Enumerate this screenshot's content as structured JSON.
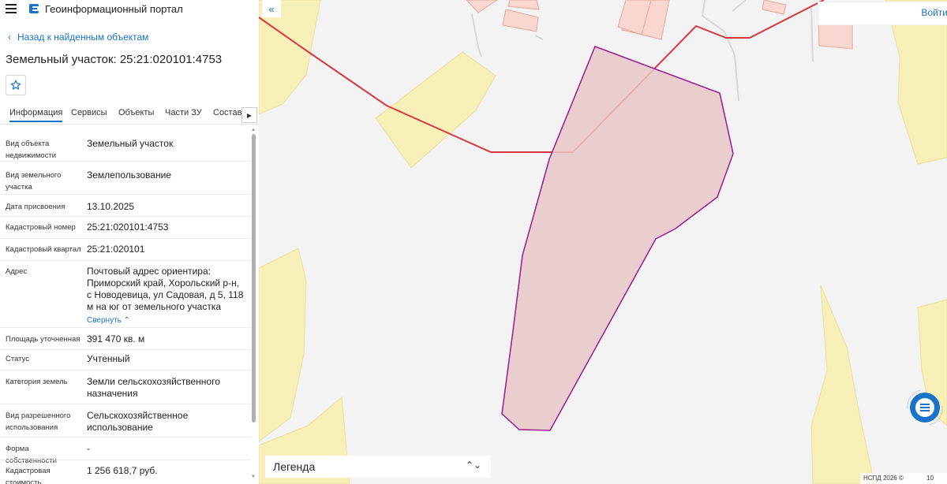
{
  "header": {
    "app_title": "Геоинформационный портал"
  },
  "back_link": "Назад к найденным объектам",
  "page_title": "Земельный участок: 25:21:020101:4753",
  "tabs": [
    {
      "label": "Информация",
      "active": true
    },
    {
      "label": "Сервисы"
    },
    {
      "label": "Объекты"
    },
    {
      "label": "Части ЗУ"
    },
    {
      "label": "Состав"
    }
  ],
  "properties": [
    {
      "label": "Вид объекта недвижимости",
      "value": "Земельный участок"
    },
    {
      "label": "Вид земельного участка",
      "value": "Землепользование"
    },
    {
      "label": "Дата присвоения",
      "value": "13.10.2025"
    },
    {
      "label": "Кадастровый номер",
      "value": "25:21:020101:4753"
    },
    {
      "label": "Кадастровый квартал",
      "value": "25:21:020101"
    },
    {
      "label": "Адрес",
      "value": "Почтовый адрес ориентира: Приморский край, Хорольский р-н, с Новодевица, ул Садовая, д 5, 118 м на юг от земельного участка",
      "action": "Свернуть"
    },
    {
      "label": "Площадь уточненная",
      "value": "391 470 кв. м"
    },
    {
      "label": "Статус",
      "value": "Учтенный"
    },
    {
      "label": "Категория земель",
      "value": "Земли сельскохозяйственного назначения"
    },
    {
      "label": "Вид разрешенного использования",
      "value": "Сельскохозяйственное использование"
    },
    {
      "label": "Форма собственности",
      "value": "-"
    },
    {
      "label": "Кадастровая стоимость",
      "value": "1 256 618,7 руб."
    }
  ],
  "map": {
    "login_label": "Войти",
    "legend_label": "Легенда",
    "copyright": "НСПД 2026 ©",
    "scale_fragment": "10"
  },
  "colors": {
    "accent": "#1a73c8",
    "parcel_fill": "#e8c5c8",
    "parcel_stroke": "#9b1a8e",
    "boundary_line": "#d9363e",
    "yellow_zone": "#f7efb8",
    "building_fill": "#f9d6cf"
  },
  "icons": {
    "menu": "hamburger-icon",
    "logo": "portal-logo-icon",
    "star": "star-outline-icon",
    "collapse": "double-chevron-left-icon",
    "chat": "chat-icon",
    "legend_toggle": "updown-chevron-icon"
  }
}
